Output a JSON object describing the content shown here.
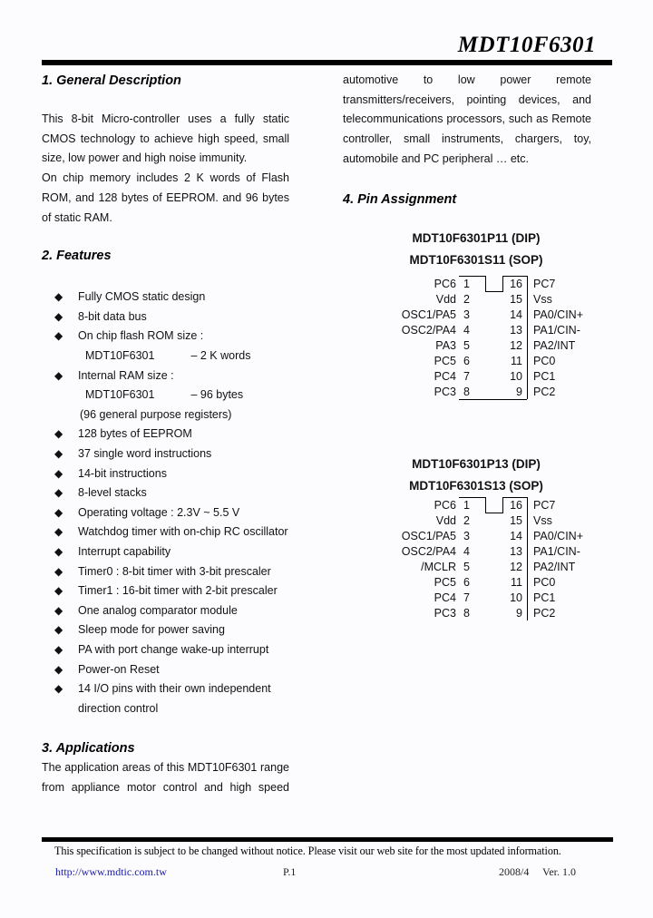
{
  "header": {
    "title": "MDT10F6301"
  },
  "general_description": {
    "heading": "1. General Description",
    "para1_lines": [
      "This 8-bit Micro-controller uses a fully static",
      "CMOS technology to achieve high speed, small",
      "size, low power and high noise immunity."
    ],
    "para2_lines": [
      "On chip memory includes 2 K words of Flash",
      "ROM, and 128 bytes of EEPROM. and 96 bytes",
      "of static RAM."
    ]
  },
  "features": {
    "heading": "2. Features",
    "bullet_glyph": "◆",
    "items": [
      {
        "type": "bullet",
        "text": "Fully CMOS static design"
      },
      {
        "type": "bullet",
        "text": "8-bit data bus"
      },
      {
        "type": "bullet",
        "text": "On chip flash ROM size :"
      },
      {
        "type": "sub",
        "left": "MDT10F6301",
        "right": "– 2 K words"
      },
      {
        "type": "bullet",
        "text": "Internal RAM size :"
      },
      {
        "type": "sub",
        "left": "MDT10F6301",
        "right": "– 96 bytes"
      },
      {
        "type": "note",
        "text": "(96 general purpose registers)"
      },
      {
        "type": "bullet",
        "text": "128 bytes of EEPROM"
      },
      {
        "type": "bullet",
        "text": "37 single word instructions"
      },
      {
        "type": "bullet",
        "text": "14-bit instructions"
      },
      {
        "type": "bullet",
        "text": "8-level stacks"
      },
      {
        "type": "bullet",
        "text": "Operating voltage : 2.3V ~ 5.5 V"
      },
      {
        "type": "bullet",
        "text": "Watchdog timer with on-chip RC oscillator"
      },
      {
        "type": "bullet",
        "text": "Interrupt capability"
      },
      {
        "type": "bullet",
        "text": "Timer0 : 8-bit timer with 3-bit prescaler"
      },
      {
        "type": "bullet",
        "text": "Timer1 : 16-bit timer with 2-bit prescaler"
      },
      {
        "type": "bullet",
        "text": "One analog comparator module"
      },
      {
        "type": "bullet",
        "text": "Sleep mode for power saving"
      },
      {
        "type": "bullet",
        "text": "PA with port change wake-up interrupt"
      },
      {
        "type": "bullet",
        "text": "Power-on Reset"
      },
      {
        "type": "bullet",
        "text": "14 I/O pins with their own independent"
      },
      {
        "type": "cont",
        "text": "direction control"
      }
    ]
  },
  "applications": {
    "heading": "3. Applications",
    "left_lines": [
      "The application areas of this MDT10F6301 range",
      "from appliance motor control and high speed"
    ],
    "right_lines": [
      "automotive to low power remote",
      "transmitters/receivers, pointing devices, and",
      "telecommunications processors, such as Remote",
      "controller, small instruments, chargers, toy,",
      "automobile and PC peripheral … etc."
    ]
  },
  "pin_assignment": {
    "heading": "4. Pin Assignment",
    "packages": [
      {
        "titles": [
          "MDT10F6301P11 (DIP)",
          "MDT10F6301S11 (SOP)"
        ],
        "rows": [
          {
            "lname": "PC6",
            "lnum": "1",
            "rnum": "16",
            "rname": "PC7"
          },
          {
            "lname": "Vdd",
            "lnum": "2",
            "rnum": "15",
            "rname": "Vss"
          },
          {
            "lname": "OSC1/PA5",
            "lnum": "3",
            "rnum": "14",
            "rname": "PA0/CIN+"
          },
          {
            "lname": "OSC2/PA4",
            "lnum": "4",
            "rnum": "13",
            "rname": "PA1/CIN-"
          },
          {
            "lname": "PA3",
            "lnum": "5",
            "rnum": "12",
            "rname": "PA2/INT"
          },
          {
            "lname": "PC5",
            "lnum": "6",
            "rnum": "11",
            "rname": "PC0"
          },
          {
            "lname": "PC4",
            "lnum": "7",
            "rnum": "10",
            "rname": "PC1"
          },
          {
            "lname": "PC3",
            "lnum": "8",
            "rnum": "9",
            "rname": "PC2"
          }
        ]
      },
      {
        "titles": [
          "MDT10F6301P13 (DIP)",
          "MDT10F6301S13 (SOP)"
        ],
        "rows": [
          {
            "lname": "PC6",
            "lnum": "1",
            "rnum": "16",
            "rname": "PC7"
          },
          {
            "lname": "Vdd",
            "lnum": "2",
            "rnum": "15",
            "rname": "Vss"
          },
          {
            "lname": "OSC1/PA5",
            "lnum": "3",
            "rnum": "14",
            "rname": "PA0/CIN+"
          },
          {
            "lname": "OSC2/PA4",
            "lnum": "4",
            "rnum": "13",
            "rname": "PA1/CIN-"
          },
          {
            "lname": "/MCLR",
            "lnum": "5",
            "rnum": "12",
            "rname": "PA2/INT"
          },
          {
            "lname": "PC5",
            "lnum": "6",
            "rnum": "11",
            "rname": "PC0"
          },
          {
            "lname": "PC4",
            "lnum": "7",
            "rnum": "10",
            "rname": "PC1"
          },
          {
            "lname": "PC3",
            "lnum": "8",
            "rnum": "9",
            "rname": "PC2"
          }
        ]
      }
    ]
  },
  "footer": {
    "notice": "This specification is subject to be changed without notice. Please visit our web site for the most updated information.",
    "url": "http://www.mdtic.com.tw",
    "page": "P.1",
    "date": "2008/4",
    "version": "Ver. 1.0",
    "link_color": "#1a1aa6"
  }
}
